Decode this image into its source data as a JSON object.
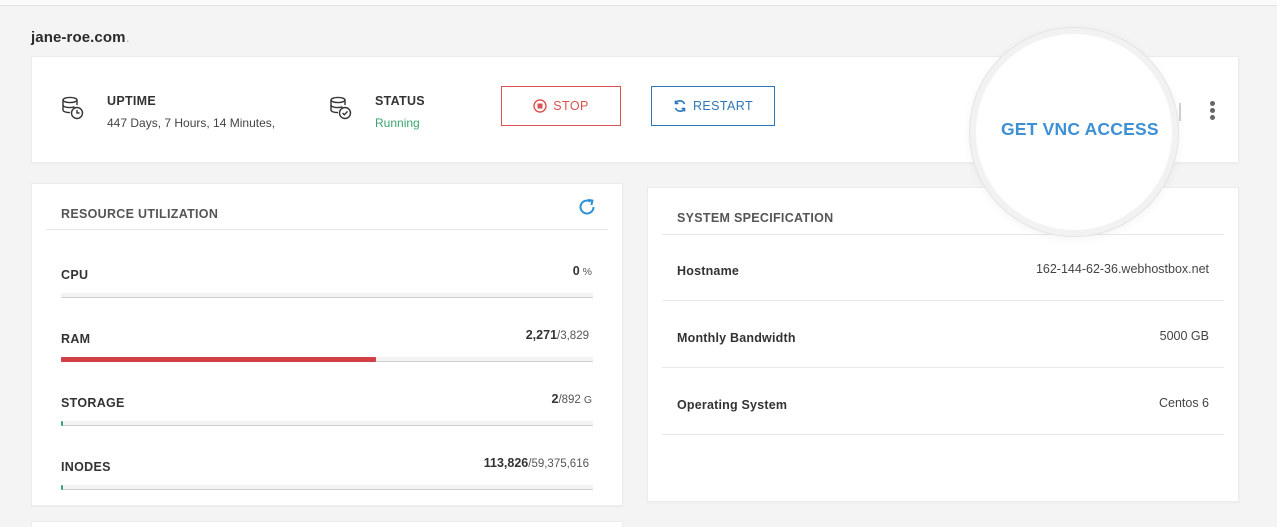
{
  "header": {
    "domain": "jane-roe.com",
    "domain_dot": "."
  },
  "status_bar": {
    "uptime": {
      "label": "UPTIME",
      "value": "447 Days, 7 Hours, 14 Minutes,"
    },
    "status": {
      "label": "STATUS",
      "value": "Running",
      "color": "#3aa76d"
    },
    "stop_label": "STOP",
    "restart_label": "RESTART",
    "vnc_label": "GET VNC ACCESS"
  },
  "resource_utilization": {
    "title": "RESOURCE UTILIZATION",
    "items": [
      {
        "label": "CPU",
        "used": "0",
        "sep": "",
        "total": "",
        "unit": "%",
        "fraction": 0.0,
        "color": "#3aa76d"
      },
      {
        "label": "RAM",
        "used": "2,271",
        "sep": "/",
        "total": "3,829",
        "unit": "",
        "fraction": 0.593,
        "color": "#d23f46"
      },
      {
        "label": "STORAGE",
        "used": "2",
        "sep": "/",
        "total": "892",
        "unit": "G",
        "fraction": 0.002,
        "color": "#3aa76d"
      },
      {
        "label": "INODES",
        "used": "113,826",
        "sep": "/",
        "total": "59,375,616",
        "unit": "",
        "fraction": 0.002,
        "color": "#3aa76d"
      }
    ]
  },
  "system_specification": {
    "title": "SYSTEM SPECIFICATION",
    "rows": [
      {
        "label": "Hostname",
        "value": "162-144-62-36.webhostbox.net"
      },
      {
        "label": "Monthly Bandwidth",
        "value": "5000 GB"
      },
      {
        "label": "Operating System",
        "value": "Centos 6"
      }
    ]
  },
  "colors": {
    "accent": "#2d77b8",
    "danger": "#d9534f",
    "vnc": "#3d8fd6",
    "success": "#3aa76d"
  }
}
